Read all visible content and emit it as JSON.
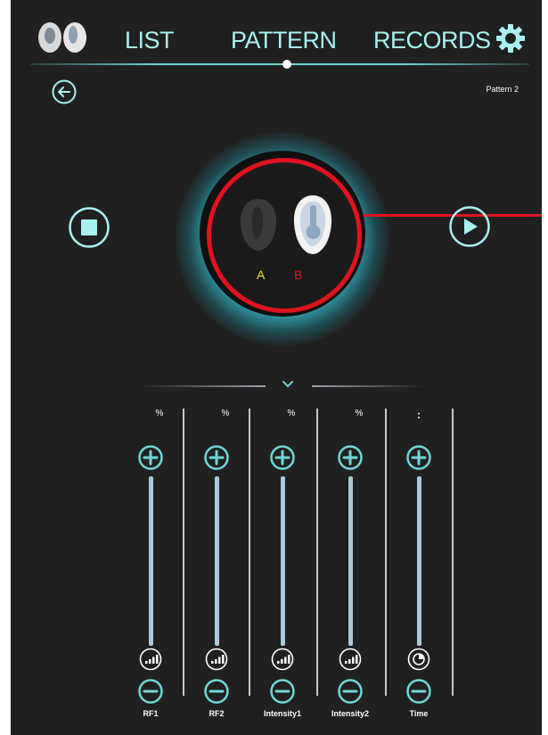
{
  "nav": {
    "tabs": [
      {
        "label": "LIST"
      },
      {
        "label": "PATTERN",
        "active": true
      },
      {
        "label": "RECORDS"
      }
    ],
    "settings_icon": "gear-icon",
    "logo_icon": "earbuds-icon"
  },
  "header": {
    "back_icon": "back-arrow-icon",
    "pattern_name": "Pattern 2"
  },
  "device": {
    "left_label": "A",
    "right_label": "B",
    "selected": "B",
    "stop_icon": "stop-icon",
    "play_icon": "play-icon"
  },
  "sliders": [
    {
      "label": "RF1",
      "unit": "%",
      "icon": "signal-strength-icon"
    },
    {
      "label": "RF2",
      "unit": "%",
      "icon": "signal-strength-icon"
    },
    {
      "label": "Intensity1",
      "unit": "%",
      "icon": "signal-strength-icon"
    },
    {
      "label": "Intensity2",
      "unit": "%",
      "icon": "signal-strength-icon"
    },
    {
      "label": "Time",
      "unit": ":",
      "icon": "clock-icon"
    }
  ],
  "colors": {
    "background": "#202020",
    "accent": "#6fd6d6",
    "nav_text": "#a9f1f1",
    "selected_ring": "#e0131f",
    "label_a": "#f2e21d",
    "label_b": "#e0131f",
    "track": "#a8c9de"
  }
}
